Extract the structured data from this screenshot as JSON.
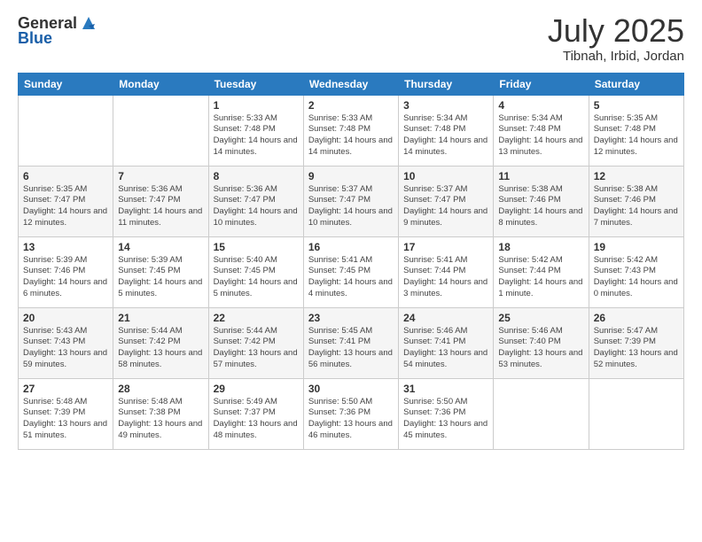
{
  "header": {
    "logo_general": "General",
    "logo_blue": "Blue",
    "month": "July 2025",
    "location": "Tibnah, Irbid, Jordan"
  },
  "weekdays": [
    "Sunday",
    "Monday",
    "Tuesday",
    "Wednesday",
    "Thursday",
    "Friday",
    "Saturday"
  ],
  "weeks": [
    [
      {
        "day": "",
        "info": ""
      },
      {
        "day": "",
        "info": ""
      },
      {
        "day": "1",
        "info": "Sunrise: 5:33 AM\nSunset: 7:48 PM\nDaylight: 14 hours\nand 14 minutes."
      },
      {
        "day": "2",
        "info": "Sunrise: 5:33 AM\nSunset: 7:48 PM\nDaylight: 14 hours\nand 14 minutes."
      },
      {
        "day": "3",
        "info": "Sunrise: 5:34 AM\nSunset: 7:48 PM\nDaylight: 14 hours\nand 14 minutes."
      },
      {
        "day": "4",
        "info": "Sunrise: 5:34 AM\nSunset: 7:48 PM\nDaylight: 14 hours\nand 13 minutes."
      },
      {
        "day": "5",
        "info": "Sunrise: 5:35 AM\nSunset: 7:48 PM\nDaylight: 14 hours\nand 12 minutes."
      }
    ],
    [
      {
        "day": "6",
        "info": "Sunrise: 5:35 AM\nSunset: 7:47 PM\nDaylight: 14 hours\nand 12 minutes."
      },
      {
        "day": "7",
        "info": "Sunrise: 5:36 AM\nSunset: 7:47 PM\nDaylight: 14 hours\nand 11 minutes."
      },
      {
        "day": "8",
        "info": "Sunrise: 5:36 AM\nSunset: 7:47 PM\nDaylight: 14 hours\nand 10 minutes."
      },
      {
        "day": "9",
        "info": "Sunrise: 5:37 AM\nSunset: 7:47 PM\nDaylight: 14 hours\nand 10 minutes."
      },
      {
        "day": "10",
        "info": "Sunrise: 5:37 AM\nSunset: 7:47 PM\nDaylight: 14 hours\nand 9 minutes."
      },
      {
        "day": "11",
        "info": "Sunrise: 5:38 AM\nSunset: 7:46 PM\nDaylight: 14 hours\nand 8 minutes."
      },
      {
        "day": "12",
        "info": "Sunrise: 5:38 AM\nSunset: 7:46 PM\nDaylight: 14 hours\nand 7 minutes."
      }
    ],
    [
      {
        "day": "13",
        "info": "Sunrise: 5:39 AM\nSunset: 7:46 PM\nDaylight: 14 hours\nand 6 minutes."
      },
      {
        "day": "14",
        "info": "Sunrise: 5:39 AM\nSunset: 7:45 PM\nDaylight: 14 hours\nand 5 minutes."
      },
      {
        "day": "15",
        "info": "Sunrise: 5:40 AM\nSunset: 7:45 PM\nDaylight: 14 hours\nand 5 minutes."
      },
      {
        "day": "16",
        "info": "Sunrise: 5:41 AM\nSunset: 7:45 PM\nDaylight: 14 hours\nand 4 minutes."
      },
      {
        "day": "17",
        "info": "Sunrise: 5:41 AM\nSunset: 7:44 PM\nDaylight: 14 hours\nand 3 minutes."
      },
      {
        "day": "18",
        "info": "Sunrise: 5:42 AM\nSunset: 7:44 PM\nDaylight: 14 hours\nand 1 minute."
      },
      {
        "day": "19",
        "info": "Sunrise: 5:42 AM\nSunset: 7:43 PM\nDaylight: 14 hours\nand 0 minutes."
      }
    ],
    [
      {
        "day": "20",
        "info": "Sunrise: 5:43 AM\nSunset: 7:43 PM\nDaylight: 13 hours\nand 59 minutes."
      },
      {
        "day": "21",
        "info": "Sunrise: 5:44 AM\nSunset: 7:42 PM\nDaylight: 13 hours\nand 58 minutes."
      },
      {
        "day": "22",
        "info": "Sunrise: 5:44 AM\nSunset: 7:42 PM\nDaylight: 13 hours\nand 57 minutes."
      },
      {
        "day": "23",
        "info": "Sunrise: 5:45 AM\nSunset: 7:41 PM\nDaylight: 13 hours\nand 56 minutes."
      },
      {
        "day": "24",
        "info": "Sunrise: 5:46 AM\nSunset: 7:41 PM\nDaylight: 13 hours\nand 54 minutes."
      },
      {
        "day": "25",
        "info": "Sunrise: 5:46 AM\nSunset: 7:40 PM\nDaylight: 13 hours\nand 53 minutes."
      },
      {
        "day": "26",
        "info": "Sunrise: 5:47 AM\nSunset: 7:39 PM\nDaylight: 13 hours\nand 52 minutes."
      }
    ],
    [
      {
        "day": "27",
        "info": "Sunrise: 5:48 AM\nSunset: 7:39 PM\nDaylight: 13 hours\nand 51 minutes."
      },
      {
        "day": "28",
        "info": "Sunrise: 5:48 AM\nSunset: 7:38 PM\nDaylight: 13 hours\nand 49 minutes."
      },
      {
        "day": "29",
        "info": "Sunrise: 5:49 AM\nSunset: 7:37 PM\nDaylight: 13 hours\nand 48 minutes."
      },
      {
        "day": "30",
        "info": "Sunrise: 5:50 AM\nSunset: 7:36 PM\nDaylight: 13 hours\nand 46 minutes."
      },
      {
        "day": "31",
        "info": "Sunrise: 5:50 AM\nSunset: 7:36 PM\nDaylight: 13 hours\nand 45 minutes."
      },
      {
        "day": "",
        "info": ""
      },
      {
        "day": "",
        "info": ""
      }
    ]
  ]
}
